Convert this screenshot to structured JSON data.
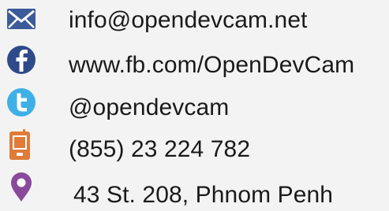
{
  "contacts": {
    "email": {
      "text": "info@opendevcam.net",
      "icon": "envelope-icon",
      "color": "#3b5b9a"
    },
    "facebook": {
      "text": "www.fb.com/OpenDevCam",
      "icon": "facebook-icon",
      "color": "#2f4a8a"
    },
    "twitter": {
      "text": "@opendevcam",
      "icon": "twitter-icon",
      "color": "#3fb0e6"
    },
    "phone": {
      "text": "(855) 23 224 782",
      "icon": "phone-icon",
      "color": "#e07b39"
    },
    "address": {
      "text": "43 St. 208, Phnom Penh",
      "icon": "map-pin-icon",
      "color": "#8a4a9c"
    }
  }
}
